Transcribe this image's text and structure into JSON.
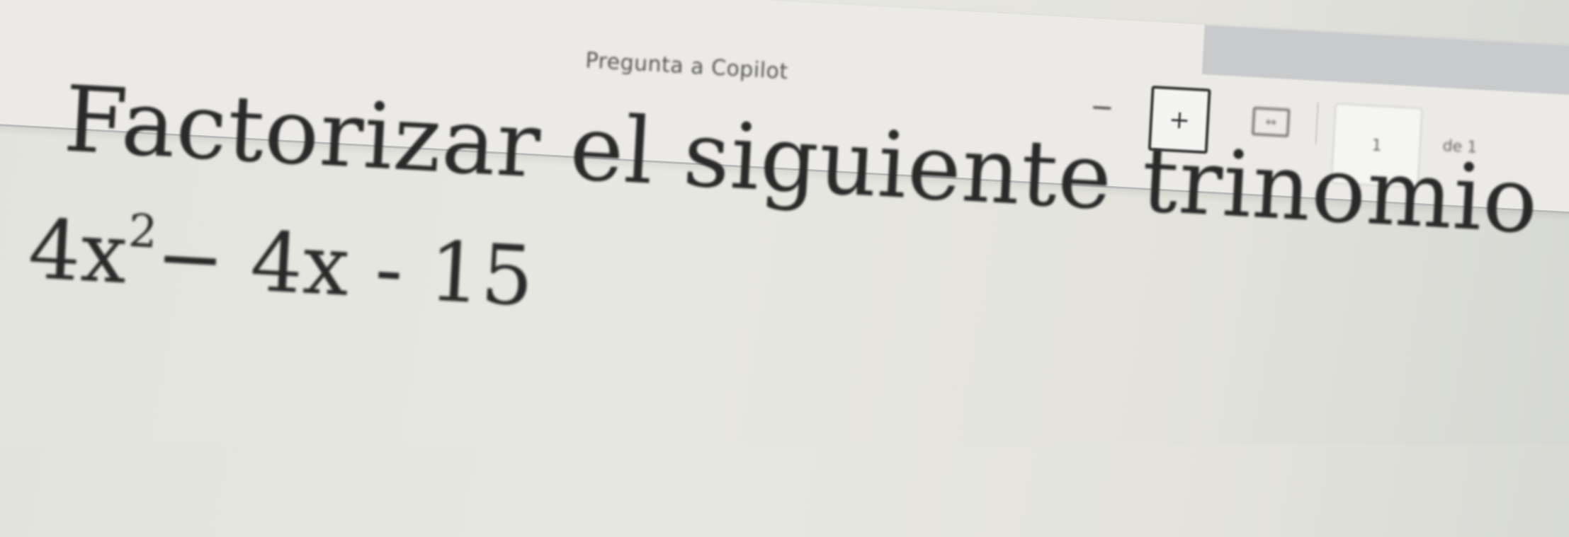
{
  "toolbar": {
    "ask_copilot_text": "Pregunta a Copilot",
    "zoom_out_label": "−",
    "zoom_in_label": "+",
    "current_page": "1",
    "page_total_label": "de 1"
  },
  "document": {
    "heading": "Factorizar el siguiente trinomio",
    "expression": {
      "coef": "4x",
      "exponent": "2",
      "rest": "− 4x - 15"
    }
  }
}
